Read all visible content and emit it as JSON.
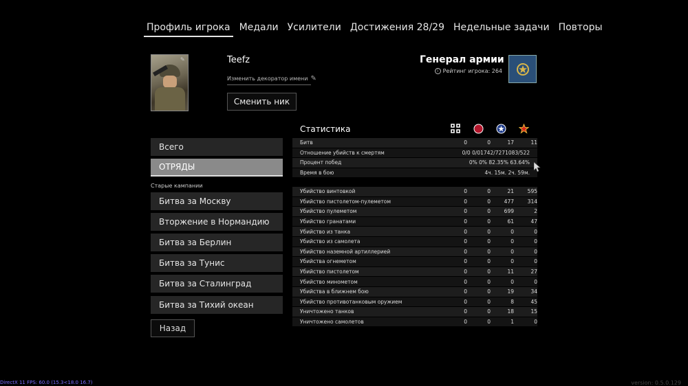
{
  "tabs": [
    {
      "label": "Профиль игрока",
      "active": true
    },
    {
      "label": "Медали",
      "active": false
    },
    {
      "label": "Усилители",
      "active": false
    },
    {
      "label": "Достижения 28/29",
      "active": false
    },
    {
      "label": "Недельные задачи",
      "active": false
    },
    {
      "label": "Повторы",
      "active": false
    }
  ],
  "profile": {
    "name": "Teefz",
    "decorator_label": "Изменить декоратор имени",
    "change_nick_label": "Сменить ник",
    "rank_title": "Генерал армии",
    "rating_text": "Рейтинг игрока: 264",
    "rank_badge_color": "#2a4f78"
  },
  "menu": {
    "total": "Всего",
    "squads": "ОТРЯДЫ",
    "old_campaigns_label": "Старые кампании",
    "campaigns": [
      "Битва за Москву",
      "Вторжение в Нормандию",
      "Битва за Берлин",
      "Битва за Тунис",
      "Битва за Сталинград",
      "Битва за Тихий океан"
    ],
    "back": "Назад"
  },
  "stats": {
    "title": "Статистика",
    "factions": [
      "germany-cross-icon",
      "japan-sun-icon",
      "usa-star-icon",
      "ussr-star-icon"
    ],
    "summary": [
      {
        "label": "Битв",
        "values": [
          "0",
          "0",
          "17",
          "11"
        ]
      },
      {
        "label": "Отношение убийств к смертям",
        "combined": "0/0      0/01742/7271083/522"
      },
      {
        "label": "Процент побед",
        "combined": "0%      0%   82.35%   63.64%"
      },
      {
        "label": "Время в бою",
        "combined": "4ч. 15м. 2ч. 59м."
      }
    ],
    "kills": [
      {
        "label": "Убийство винтовкой",
        "values": [
          "0",
          "0",
          "21",
          "595"
        ]
      },
      {
        "label": "Убийство пистолетом-пулеметом",
        "values": [
          "0",
          "0",
          "477",
          "314"
        ]
      },
      {
        "label": "Убийство пулеметом",
        "values": [
          "0",
          "0",
          "699",
          "2"
        ]
      },
      {
        "label": "Убийство гранатами",
        "values": [
          "0",
          "0",
          "61",
          "47"
        ]
      },
      {
        "label": "Убийство из танка",
        "values": [
          "0",
          "0",
          "0",
          "0"
        ]
      },
      {
        "label": "Убийство из самолета",
        "values": [
          "0",
          "0",
          "0",
          "0"
        ]
      },
      {
        "label": "Убийство наземной артиллерией",
        "values": [
          "0",
          "0",
          "0",
          "0"
        ]
      },
      {
        "label": "Убийства огнеметом",
        "values": [
          "0",
          "0",
          "0",
          "0"
        ]
      },
      {
        "label": "Убийство пистолетом",
        "values": [
          "0",
          "0",
          "11",
          "27"
        ]
      },
      {
        "label": "Убийство минометом",
        "values": [
          "0",
          "0",
          "0",
          "0"
        ]
      },
      {
        "label": "Убийства в ближнем бою",
        "values": [
          "0",
          "0",
          "19",
          "34"
        ]
      },
      {
        "label": "Убийство противотанковым оружием",
        "values": [
          "0",
          "0",
          "8",
          "45"
        ]
      },
      {
        "label": "Уничтожено танков",
        "values": [
          "0",
          "0",
          "18",
          "15"
        ]
      },
      {
        "label": "Уничтожено самолетов",
        "values": [
          "0",
          "0",
          "1",
          "0"
        ]
      }
    ]
  },
  "footer": {
    "fps": "DirectX 11 FPS: 60.0 (15.3<18.0 16.7)",
    "version": "version: 0.5.0.129"
  }
}
